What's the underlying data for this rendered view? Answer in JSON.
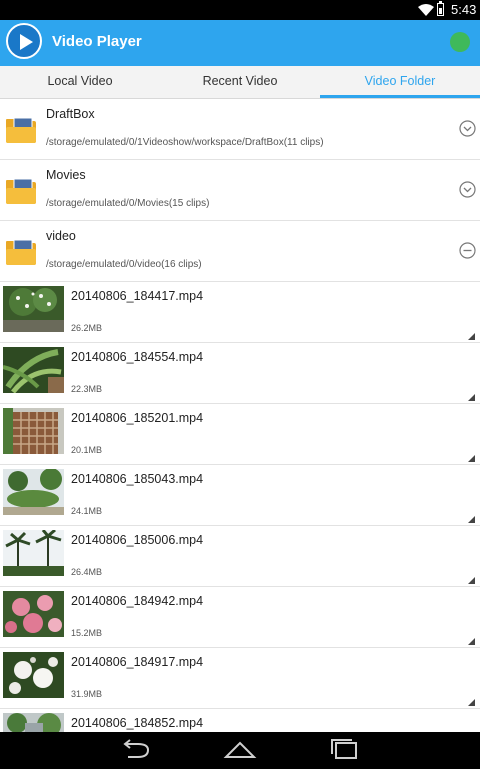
{
  "status_bar": {
    "time": "5:43",
    "icons": [
      "wifi-icon",
      "battery-icon"
    ],
    "battery_level": 0.75
  },
  "app_bar": {
    "title": "Video Player",
    "logo_icon": "play-circle-icon",
    "action_icon": "green-circle-icon",
    "background_color": "#2ea5ee"
  },
  "tabs": [
    {
      "label": "Local Video",
      "active": false
    },
    {
      "label": "Recent Video",
      "active": false
    },
    {
      "label": "Video Folder",
      "active": true
    }
  ],
  "folders": [
    {
      "name": "DraftBox",
      "path": "/storage/emulated/0/1Videoshow/workspace/DraftBox(11 clips)",
      "expanded": false,
      "toggle_icon": "chevron-down-circle-icon"
    },
    {
      "name": "Movies",
      "path": "/storage/emulated/0/Movies(15 clips)",
      "expanded": false,
      "toggle_icon": "chevron-down-circle-icon"
    },
    {
      "name": "video",
      "path": "/storage/emulated/0/video(16 clips)",
      "expanded": true,
      "toggle_icon": "minus-circle-icon"
    }
  ],
  "videos": [
    {
      "name": "20140806_184417.mp4",
      "size": "26.2MB",
      "thumb": "tree-white-flowers"
    },
    {
      "name": "20140806_184554.mp4",
      "size": "22.3MB",
      "thumb": "palm-leaves"
    },
    {
      "name": "20140806_185201.mp4",
      "size": "20.1MB",
      "thumb": "wooden-fence"
    },
    {
      "name": "20140806_185043.mp4",
      "size": "24.1MB",
      "thumb": "garden-hedge"
    },
    {
      "name": "20140806_185006.mp4",
      "size": "26.4MB",
      "thumb": "palm-trees-sky"
    },
    {
      "name": "20140806_184942.mp4",
      "size": "15.2MB",
      "thumb": "pink-flowers"
    },
    {
      "name": "20140806_184917.mp4",
      "size": "31.9MB",
      "thumb": "white-flowers"
    },
    {
      "name": "20140806_184852.mp4",
      "size": "",
      "thumb": "building-trees"
    }
  ],
  "nav_bar": {
    "buttons": [
      "back-icon",
      "home-icon",
      "recent-apps-icon"
    ]
  }
}
